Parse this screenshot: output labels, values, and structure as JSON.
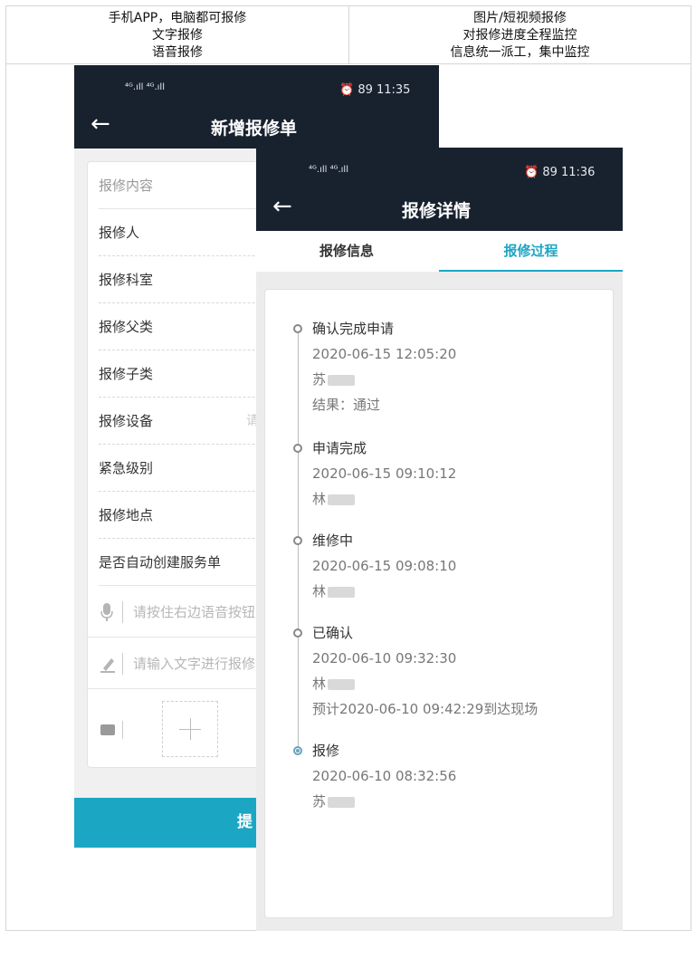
{
  "header": {
    "left_lines": [
      "手机APP，电脑都可报修",
      "文字报修",
      "语音报修"
    ],
    "right_lines": [
      "图片/短视频报修",
      "对报修进度全程监控",
      "信息统一派工，集中监控"
    ]
  },
  "phone_back": {
    "status": {
      "signal": "⁴ᴳ.ıll ⁴ᴳ.ıll",
      "right": "⏰ 89 11:35"
    },
    "title": "新增报修单",
    "form_fields": [
      {
        "label": "报修内容"
      },
      {
        "label": "报修人"
      },
      {
        "label": "报修科室"
      },
      {
        "label": "报修父类"
      },
      {
        "label": "报修子类"
      },
      {
        "label": "报修设备",
        "hint": "请"
      },
      {
        "label": "紧急级别"
      },
      {
        "label": "报修地点"
      },
      {
        "label": "是否自动创建服务单"
      }
    ],
    "voice_placeholder": "请按住右边语音按钮",
    "text_placeholder": "请输入文字进行报修",
    "submit_label": "提"
  },
  "phone_front": {
    "status": {
      "signal": "⁴ᴳ.ıll ⁴ᴳ.ıll",
      "right": "⏰ 89 11:36"
    },
    "title": "报修详情",
    "tabs": [
      {
        "label": "报修信息",
        "active": false
      },
      {
        "label": "报修过程",
        "active": true
      }
    ],
    "timeline": [
      {
        "title": "确认完成申请",
        "lines": [
          "2020-06-15 12:05:20",
          "苏",
          "结果：通过"
        ]
      },
      {
        "title": "申请完成",
        "lines": [
          "2020-06-15 09:10:12",
          "林"
        ]
      },
      {
        "title": "维修中",
        "lines": [
          "2020-06-15 09:08:10",
          "林"
        ]
      },
      {
        "title": "已确认",
        "lines": [
          "2020-06-10 09:32:30",
          "林",
          "预计2020-06-10 09:42:29到达现场"
        ]
      },
      {
        "title": "报修",
        "lines": [
          "2020-06-10 08:32:56",
          "苏"
        ]
      }
    ]
  },
  "colors": {
    "header_dark": "#18222f",
    "accent": "#1ba6c4"
  }
}
